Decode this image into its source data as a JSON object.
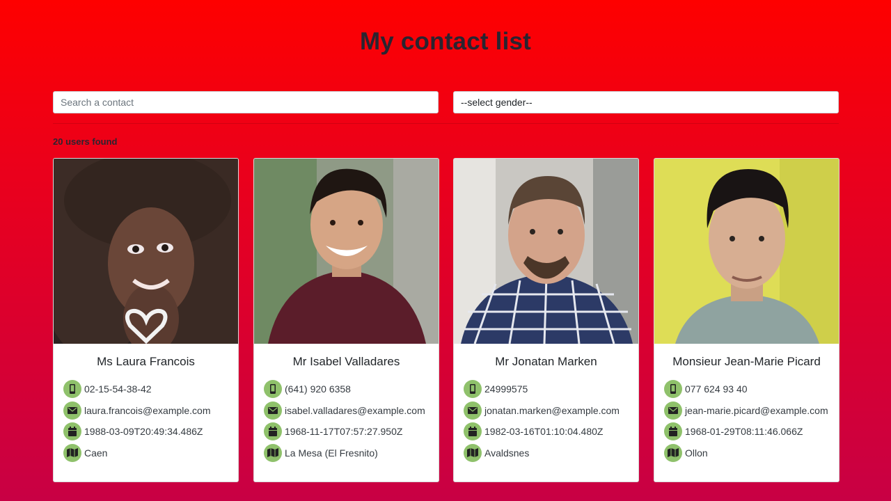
{
  "page": {
    "title": "My contact list"
  },
  "search": {
    "placeholder": "Search a contact"
  },
  "gender_select": {
    "selected": "--select gender--"
  },
  "results": {
    "count_text": "20 users found"
  },
  "colors": {
    "accent_icon_bg": "#8fc16b",
    "background_top": "#fe0000",
    "background_bottom": "#c80044"
  },
  "icons": {
    "phone": "mobile-phone-icon",
    "email": "envelope-icon",
    "dob": "calendar-icon",
    "location": "map-icon"
  },
  "contacts": [
    {
      "name": "Ms Laura Francois",
      "phone": "02-15-54-38-42",
      "email": "laura.francois@example.com",
      "dob": "1988-03-09T20:49:34.486Z",
      "location": "Caen"
    },
    {
      "name": "Mr Isabel Valladares",
      "phone": "(641) 920 6358",
      "email": "isabel.valladares@example.com",
      "dob": "1968-11-17T07:57:27.950Z",
      "location": "La Mesa (El Fresnito)"
    },
    {
      "name": "Mr Jonatan Marken",
      "phone": "24999575",
      "email": "jonatan.marken@example.com",
      "dob": "1982-03-16T01:10:04.480Z",
      "location": "Avaldsnes"
    },
    {
      "name": "Monsieur Jean-Marie Picard",
      "phone": "077 624 93 40",
      "email": "jean-marie.picard@example.com",
      "dob": "1968-01-29T08:11:46.066Z",
      "location": "Ollon"
    }
  ]
}
